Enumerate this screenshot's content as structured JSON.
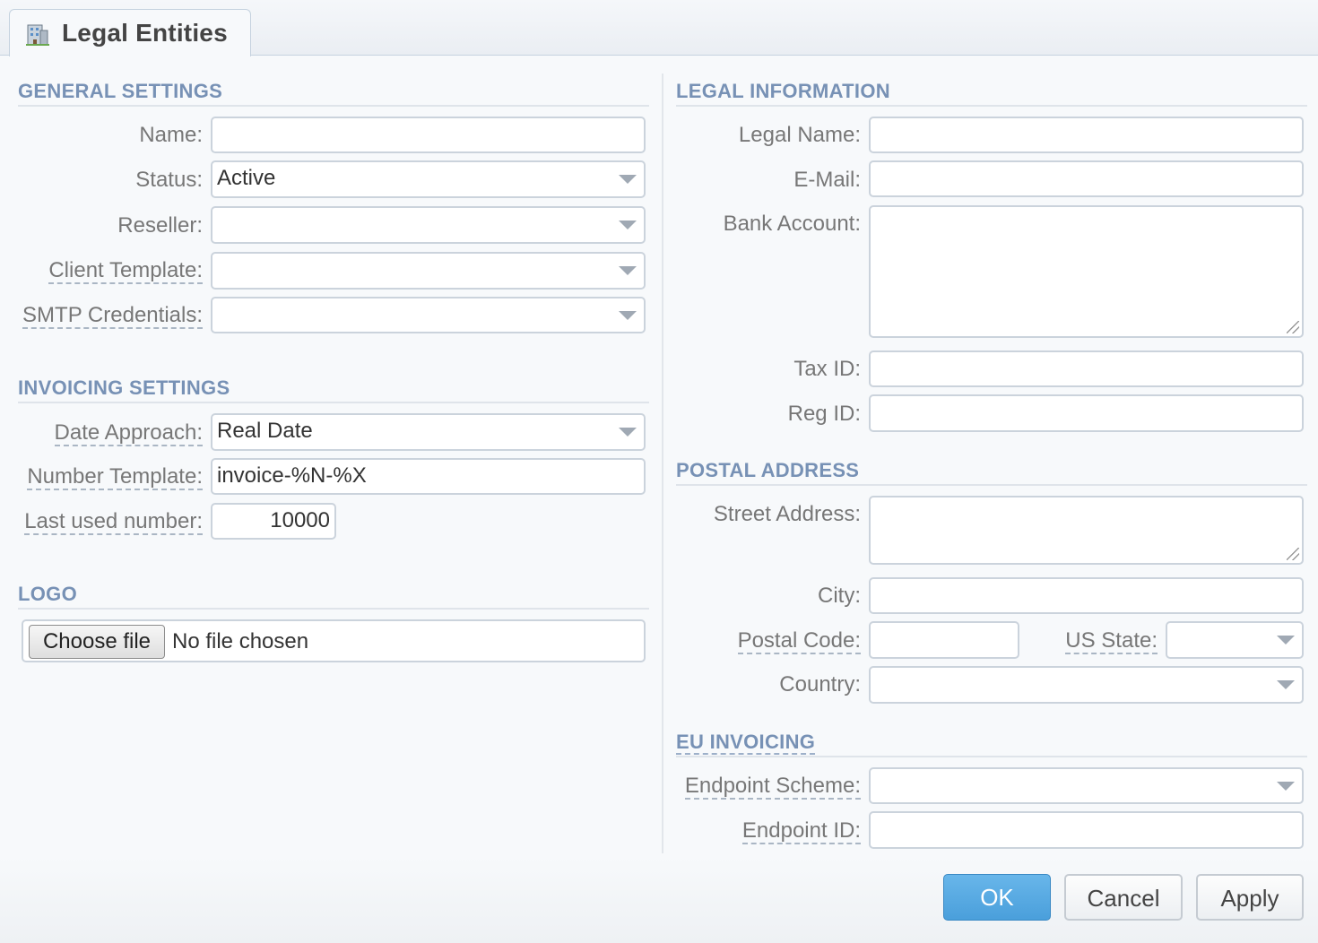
{
  "tab": {
    "title": "Legal Entities",
    "icon": "building-icon"
  },
  "general": {
    "title": "GENERAL SETTINGS",
    "name_label": "Name:",
    "name_value": "",
    "status_label": "Status:",
    "status_value": "Active",
    "reseller_label": "Reseller:",
    "reseller_value": "",
    "client_template_label": "Client Template:",
    "client_template_value": "",
    "smtp_label": "SMTP Credentials:",
    "smtp_value": ""
  },
  "invoicing": {
    "title": "INVOICING SETTINGS",
    "date_approach_label": "Date Approach:",
    "date_approach_value": "Real Date",
    "number_template_label": "Number Template:",
    "number_template_value": "invoice-%N-%X",
    "last_number_label": "Last used number:",
    "last_number_value": "10000"
  },
  "logo": {
    "title": "LOGO",
    "choose_file": "Choose file",
    "file_status": "No file chosen"
  },
  "legal": {
    "title": "LEGAL INFORMATION",
    "legal_name_label": "Legal Name:",
    "email_label": "E-Mail:",
    "bank_account_label": "Bank Account:",
    "tax_id_label": "Tax ID:",
    "reg_id_label": "Reg ID:"
  },
  "postal": {
    "title": "POSTAL ADDRESS",
    "street_label": "Street Address:",
    "city_label": "City:",
    "postal_code_label": "Postal Code:",
    "us_state_label": "US State:",
    "country_label": "Country:"
  },
  "eu": {
    "title": "EU INVOICING",
    "endpoint_scheme_label": "Endpoint Scheme:",
    "endpoint_id_label": "Endpoint ID:"
  },
  "buttons": {
    "ok": "OK",
    "cancel": "Cancel",
    "apply": "Apply"
  },
  "colors": {
    "section_title": "#7791b5",
    "ok_button": "#4a9fdb",
    "field_border": "#cbd3dc"
  }
}
